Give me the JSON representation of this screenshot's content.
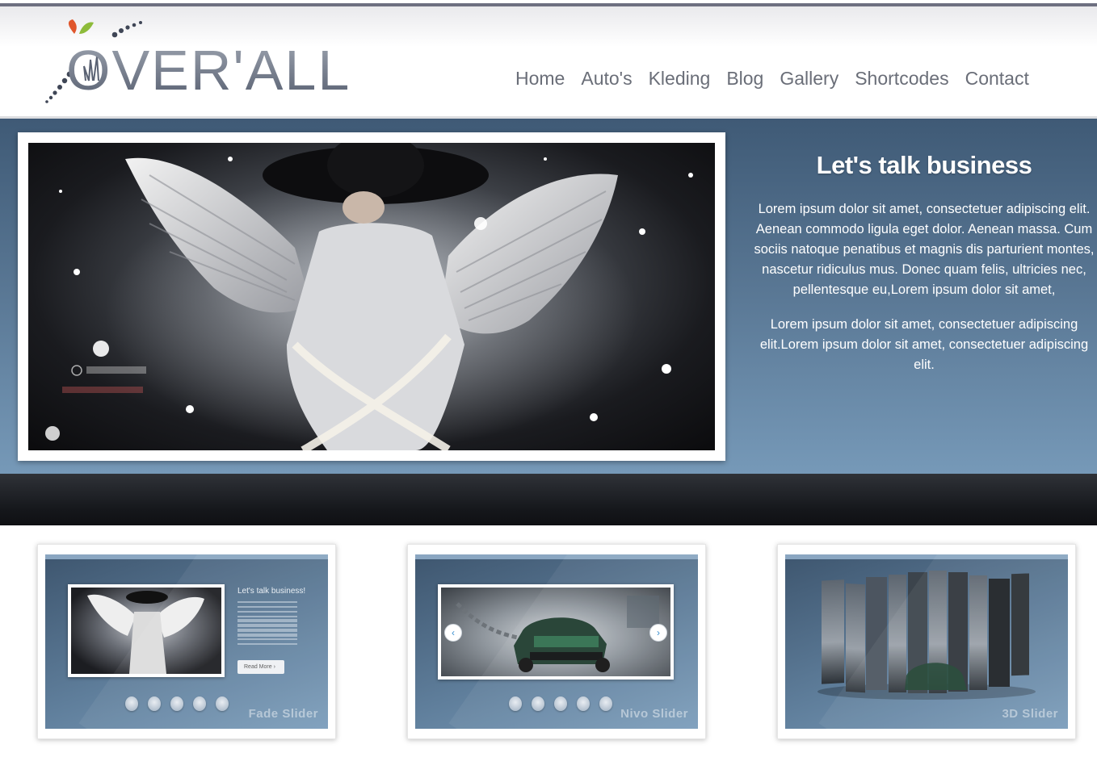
{
  "brand": {
    "logo_text": "OVER'ALL"
  },
  "nav": {
    "items": [
      {
        "label": "Home"
      },
      {
        "label": "Auto's"
      },
      {
        "label": "Kleding"
      },
      {
        "label": "Blog"
      },
      {
        "label": "Gallery"
      },
      {
        "label": "Shortcodes"
      },
      {
        "label": "Contact"
      }
    ]
  },
  "hero": {
    "title": "Let's talk business",
    "paragraph_1": "Lorem ipsum dolor sit amet, consectetuer adipiscing elit. Aenean commodo ligula eget dolor. Aenean massa. Cum sociis natoque penatibus et magnis dis parturient montes, nascetur ridiculus mus. Donec quam felis, ultricies nec, pellentesque eu,Lorem ipsum dolor sit amet,",
    "paragraph_2": "Lorem ipsum dolor sit amet, consectetuer adipiscing elit.Lorem ipsum dolor sit amet, consectetuer adipiscing elit.",
    "image_icon": "angel-wings-photo"
  },
  "sliders": [
    {
      "label": "Fade Slider",
      "mini_title": "Let's talk business!",
      "mini_button": "Read More"
    },
    {
      "label": "Nivo Slider"
    },
    {
      "label": "3D Slider"
    }
  ],
  "colors": {
    "nav_text": "#6a6e78",
    "hero_top": "#3f5a76",
    "hero_bottom": "#7699b8",
    "dark_band": "#15171b"
  }
}
